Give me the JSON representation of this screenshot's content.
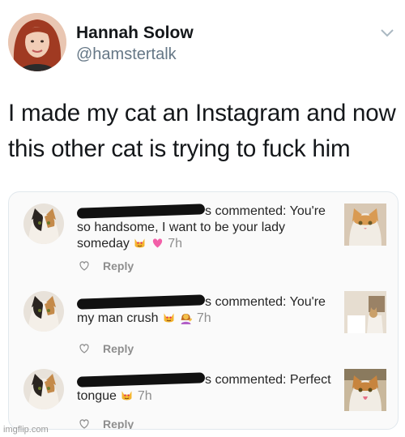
{
  "author": {
    "name": "Hannah Solow",
    "handle": "@hamstertalk"
  },
  "tweet": {
    "text": "I made my cat an Instagram and now this other cat is trying to fuck him"
  },
  "comments": [
    {
      "prefix": "s commented: You're",
      "body": "so handsome, I want to be your lady someday",
      "time": "7h",
      "reply": "Reply",
      "emoji": [
        "heart-eyes-cat-icon",
        "pink-heart-icon"
      ]
    },
    {
      "prefix": "s commented: You're",
      "body": "my man crush",
      "time": "7h",
      "reply": "Reply",
      "emoji": [
        "heart-eyes-cat-icon",
        "woman-tipping-hand-icon"
      ]
    },
    {
      "prefix": "s commented: Perfect",
      "body": "tongue",
      "time": "7h",
      "reply": "Reply",
      "emoji": [
        "heart-eyes-cat-icon"
      ]
    }
  ],
  "watermark": "imgflip.com"
}
